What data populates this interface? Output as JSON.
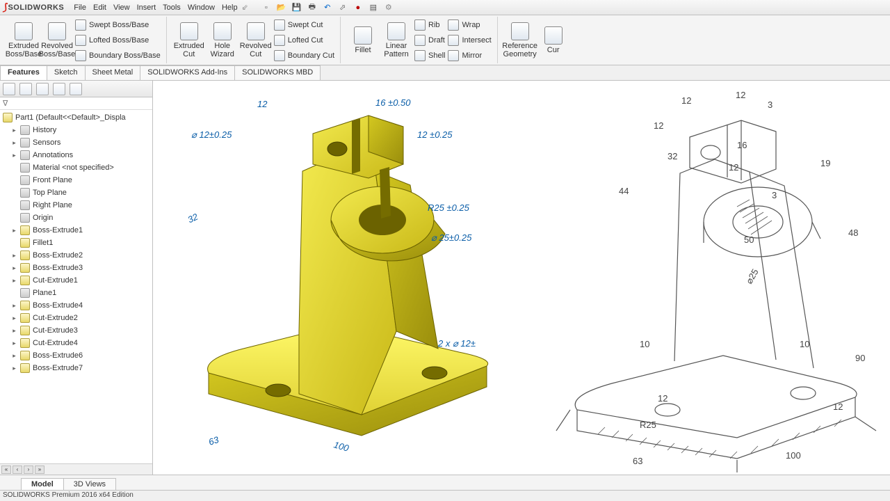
{
  "app": {
    "brand_ds": "DS",
    "brand_name": "SOLIDWORKS"
  },
  "menu": [
    "File",
    "Edit",
    "View",
    "Insert",
    "Tools",
    "Window",
    "Help"
  ],
  "ribbon": {
    "boss": {
      "extruded": "Extruded Boss/Base",
      "revolved": "Revolved Boss/Base",
      "swept": "Swept Boss/Base",
      "lofted": "Lofted Boss/Base",
      "boundary": "Boundary Boss/Base"
    },
    "cut": {
      "extruded": "Extruded Cut",
      "hole": "Hole Wizard",
      "revolved": "Revolved Cut",
      "swept": "Swept Cut",
      "lofted": "Lofted Cut",
      "boundary": "Boundary Cut"
    },
    "feat": {
      "fillet": "Fillet",
      "pattern": "Linear Pattern",
      "rib": "Rib",
      "draft": "Draft",
      "shell": "Shell",
      "wrap": "Wrap",
      "intersect": "Intersect",
      "mirror": "Mirror"
    },
    "ref": {
      "geometry": "Reference Geometry",
      "cur": "Cur"
    }
  },
  "tabs": [
    "Features",
    "Sketch",
    "Sheet Metal",
    "SOLIDWORKS Add-Ins",
    "SOLIDWORKS MBD"
  ],
  "tree": {
    "root": "Part1  (Default<<Default>_Displa",
    "nodes": [
      "History",
      "Sensors",
      "Annotations",
      "Material <not specified>",
      "Front Plane",
      "Top Plane",
      "Right Plane",
      "Origin",
      "Boss-Extrude1",
      "Fillet1",
      "Boss-Extrude2",
      "Boss-Extrude3",
      "Cut-Extrude1",
      "Plane1",
      "Boss-Extrude4",
      "Cut-Extrude2",
      "Cut-Extrude3",
      "Cut-Extrude4",
      "Boss-Extrude6",
      "Boss-Extrude7"
    ]
  },
  "dims_3d": {
    "d12_top": "12",
    "d16": "16 ±0.50",
    "d12r": "12 ±0.25",
    "phi12": "⌀ 12±0.25",
    "d32": "32",
    "r25": "R25 ±0.25",
    "phi25": "⌀ 25±0.25",
    "hole2x": "2 x ⌀ 12±",
    "d63": "63",
    "d100": "100"
  },
  "dims_sketch": {
    "d12a": "12",
    "d12b": "12",
    "d3": "3",
    "d12c": "12",
    "d32": "32",
    "d16": "16",
    "d12d": "12",
    "d19": "19",
    "d44": "44",
    "d3b": "3",
    "d50": "50",
    "d48": "48",
    "phi25": "⌀25",
    "d10a": "10",
    "d10b": "10",
    "d90": "90",
    "d12e": "12",
    "r25": "R25",
    "d12f": "12",
    "d63": "63",
    "d100": "100"
  },
  "bottom_tabs": [
    "Model",
    "3D Views"
  ],
  "status": "SOLIDWORKS Premium 2016 x64 Edition"
}
